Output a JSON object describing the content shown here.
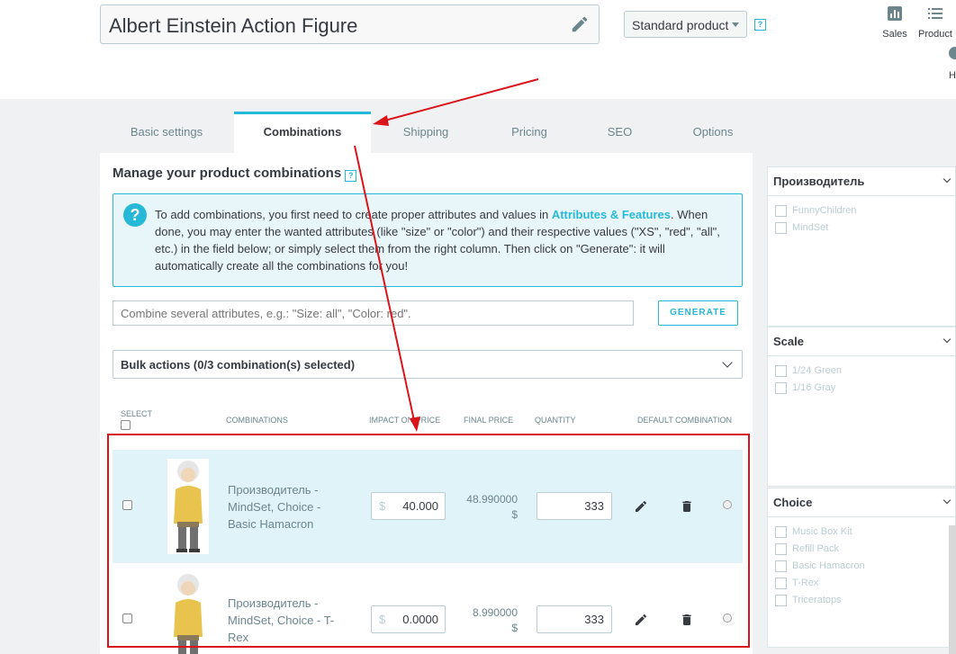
{
  "product": {
    "title": "Albert Einstein Action Figure",
    "type_select": "Standard product",
    "help": "?"
  },
  "toolbar": {
    "sales_label": "Sales",
    "product_label": "Product",
    "h_label": "H"
  },
  "tabs": [
    {
      "label": "Basic settings"
    },
    {
      "label": "Combinations"
    },
    {
      "label": "Shipping"
    },
    {
      "label": "Pricing"
    },
    {
      "label": "SEO"
    },
    {
      "label": "Options"
    }
  ],
  "active_tab": "Combinations",
  "combinations": {
    "title": "Manage your product combinations",
    "help": "?",
    "info_icon": "?",
    "info_before": "To add combinations, you first need to create proper attributes and values in ",
    "info_link": "Attributes & Features",
    "info_after": ". When done, you may enter the wanted attributes (like \"size\" or \"color\") and their respective values (\"XS\", \"red\", \"all\", etc.) in the field below; or simply select them from the right column. Then click on \"Generate\": it will automatically create all the combinations for you!",
    "input_placeholder": "Combine several attributes, e.g.: \"Size: all\", \"Color: red\".",
    "generate_label": "GENERATE",
    "bulk_label": "Bulk actions (0/3 combination(s) selected)"
  },
  "table": {
    "headers": {
      "select": "SELECT",
      "combinations": "COMBINATIONS",
      "impact": "IMPACT ON PRICE",
      "final": "FINAL PRICE",
      "quantity": "QUANTITY",
      "default": "DEFAULT COMBINATION"
    },
    "rows": [
      {
        "name": "Производитель - MindSet, Choice - Basic Hamacron",
        "currency": "$",
        "impact": "40.000",
        "final_value": "48.990000",
        "final_currency": "$",
        "quantity": "333"
      },
      {
        "name": "Производитель - MindSet, Choice - T-Rex",
        "currency": "$",
        "impact": "0.0000",
        "final_value": "8.990000",
        "final_currency": "$",
        "quantity": "333"
      }
    ]
  },
  "filters": [
    {
      "title": "Производитель",
      "options": [
        "FunnyChildren",
        "MindSet"
      ]
    },
    {
      "title": "Scale",
      "options": [
        "1/24 Green",
        "1/16 Gray"
      ]
    },
    {
      "title": "Choice",
      "options": [
        "Music Box Kit",
        "Refill Pack",
        "Basic Hamacron",
        "T-Rex",
        "Triceratops"
      ]
    }
  ],
  "colors": {
    "accent": "#25b9d7",
    "annotation_red": "#d9141b",
    "selected_row": "#e0f3f8",
    "background": "#eff1f2"
  },
  "icons": [
    "pencil-icon",
    "sales-icon",
    "list-icon",
    "question-icon",
    "trash-icon",
    "chevron-down-icon"
  ]
}
